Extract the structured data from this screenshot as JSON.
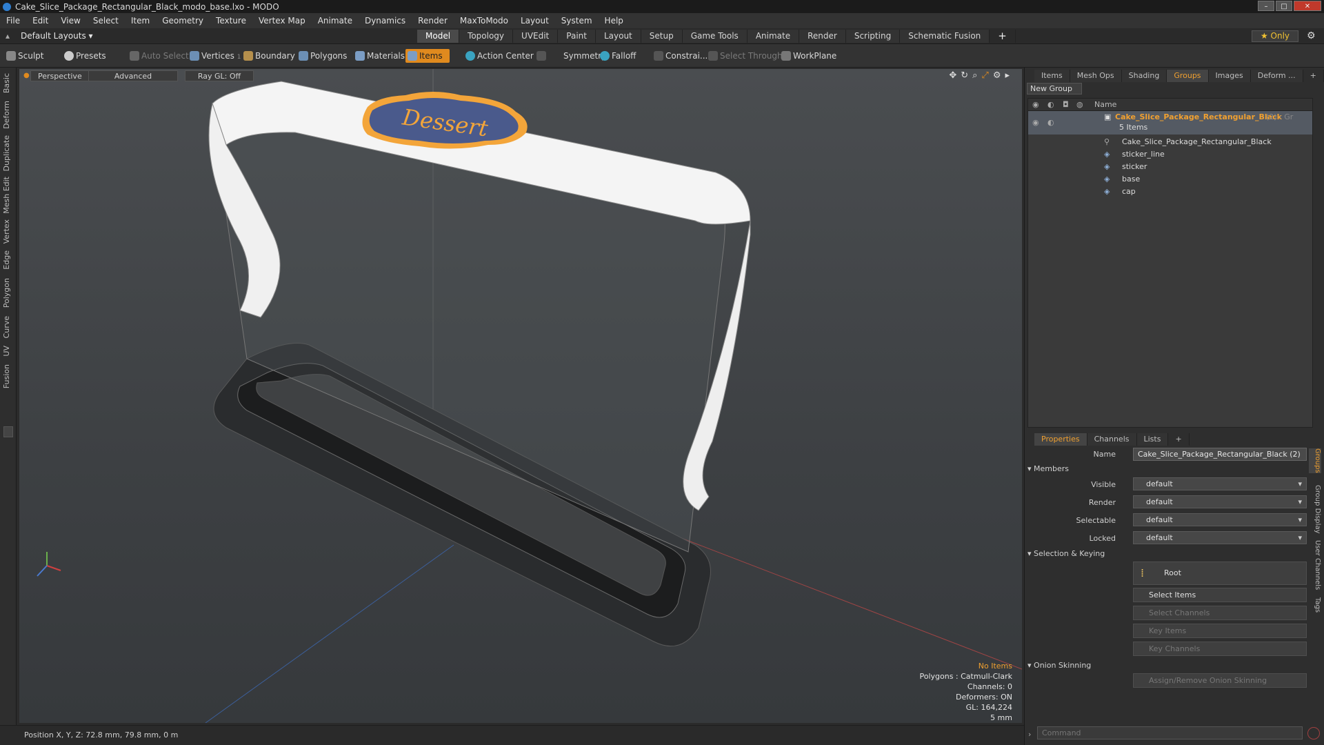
{
  "window": {
    "title": "Cake_Slice_Package_Rectangular_Black_modo_base.lxo - MODO"
  },
  "menubar": [
    "File",
    "Edit",
    "View",
    "Select",
    "Item",
    "Geometry",
    "Texture",
    "Vertex Map",
    "Animate",
    "Dynamics",
    "Render",
    "MaxToModo",
    "Layout",
    "System",
    "Help"
  ],
  "layoutbar": {
    "layout_select": "Default Layouts",
    "tabs": [
      "Model",
      "Topology",
      "UVEdit",
      "Paint",
      "Layout",
      "Setup",
      "Game Tools",
      "Animate",
      "Render",
      "Scripting",
      "Schematic Fusion"
    ],
    "active_tab": "Model",
    "only_label": "Only"
  },
  "toolbar": {
    "sculpt": "Sculpt",
    "presets": "Presets",
    "auto_select": "Auto Select",
    "vertices": "Vertices",
    "vertices_count": "1",
    "boundary": "Boundary",
    "polygons": "Polygons",
    "materials": "Materials",
    "items": "Items",
    "action_center": "Action Center",
    "symmetry": "Symmetry",
    "falloff": "Falloff",
    "constraints": "Constrai...",
    "select_through": "Select Through",
    "workplane": "WorkPlane"
  },
  "left_tabs": [
    "Basic",
    "Deform",
    "Duplicate",
    "Mesh Edit",
    "Vertex",
    "Edge",
    "Polygon",
    "Curve",
    "UV",
    "Fusion"
  ],
  "viewport": {
    "view_mode": "Perspective",
    "shading": "Advanced",
    "raygl": "Ray GL: Off",
    "sticker_text": "Dessert",
    "info": {
      "items": "No Items",
      "polygons": "Polygons : Catmull-Clark",
      "channels": "Channels: 0",
      "deformers": "Deformers: ON",
      "gl": "GL: 164,224",
      "unit": "5 mm"
    }
  },
  "statusbar": {
    "position": "Position X, Y, Z:   72.8 mm, 79.8 mm, 0 m"
  },
  "scene_panel": {
    "tabs": [
      "Items",
      "Mesh Ops",
      "Shading",
      "Groups",
      "Images",
      "Deform ..."
    ],
    "active_tab": "Groups",
    "new_group": "New Group",
    "column_name": "Name",
    "group": {
      "name": "Cake_Slice_Package_Rectangular_Black",
      "suffix": "(2) : Gr",
      "count": "5 Items"
    },
    "children": [
      "Cake_Slice_Package_Rectangular_Black",
      "sticker_line",
      "sticker",
      "base",
      "cap"
    ]
  },
  "properties_panel": {
    "tabs": [
      "Properties",
      "Channels",
      "Lists"
    ],
    "active_tab": "Properties",
    "name_label": "Name",
    "name_value": "Cake_Slice_Package_Rectangular_Black (2)",
    "members_section": "Members",
    "fields": [
      {
        "label": "Visible",
        "value": "default"
      },
      {
        "label": "Render",
        "value": "default"
      },
      {
        "label": "Selectable",
        "value": "default"
      },
      {
        "label": "Locked",
        "value": "default"
      }
    ],
    "selection_section": "Selection & Keying",
    "root_button": "Root",
    "buttons": [
      "Select Items",
      "Select Channels",
      "Key Items",
      "Key Channels"
    ],
    "onion_section": "Onion Skinning",
    "onion_button": "Assign/Remove Onion Skinning",
    "side_tabs": [
      "Groups",
      "Group Display",
      "User Channels",
      "Tags"
    ]
  },
  "command": {
    "placeholder": "Command"
  },
  "colors": {
    "accent": "#f0a030",
    "items_active": "#e08a1e"
  }
}
